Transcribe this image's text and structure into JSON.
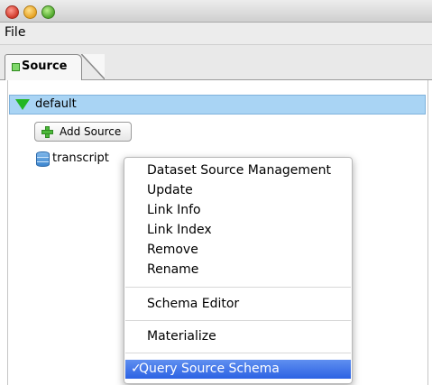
{
  "menubar": {
    "file": "File"
  },
  "tabs": [
    {
      "label": "Source"
    }
  ],
  "tree": {
    "root_label": "default",
    "add_source_label": "Add Source",
    "items": [
      {
        "label": "transcript"
      }
    ]
  },
  "context_menu": {
    "items": [
      "Dataset Source Management",
      "Update",
      "Link Info",
      "Link Index",
      "Remove",
      "Rename",
      "Schema Editor",
      "Materialize",
      "Query Source Schema"
    ],
    "checkmark": "✓"
  },
  "colors": {
    "selection_blue": "#a9d4f4",
    "menu_highlight": "#2c62e3",
    "tree_triangle": "#23b623"
  }
}
